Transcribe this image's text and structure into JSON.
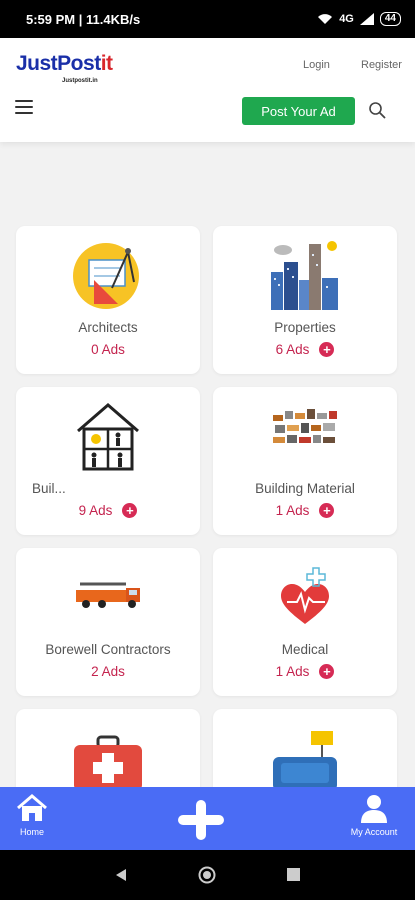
{
  "status_bar": {
    "time": "5:59 PM | 11.4KB/s",
    "network": "4G",
    "battery": "44"
  },
  "header": {
    "logo_main_a": "JustPost",
    "logo_main_b": "it",
    "logo_sub": "Justpostit.in",
    "login_label": "Login",
    "register_label": "Register",
    "post_ad_label": "Post Your Ad"
  },
  "categories": [
    {
      "title": "Architects",
      "ads": "0 Ads",
      "show_add": false,
      "icon": "architect-icon"
    },
    {
      "title": "Properties",
      "ads": "6 Ads",
      "show_add": true,
      "icon": "buildings-icon"
    },
    {
      "title": "Buil...",
      "ads": "9 Ads",
      "show_add": true,
      "icon": "builder-house-icon"
    },
    {
      "title": "Building Material",
      "ads": "1 Ads",
      "show_add": true,
      "icon": "building-material-icon"
    },
    {
      "title": "Borewell Contractors",
      "ads": "2 Ads",
      "show_add": false,
      "icon": "borewell-truck-icon"
    },
    {
      "title": "Medical",
      "ads": "1 Ads",
      "show_add": true,
      "icon": "medical-heart-icon"
    },
    {
      "title": "",
      "ads": "",
      "show_add": false,
      "icon": "first-aid-kit-icon"
    },
    {
      "title": "",
      "ads": "",
      "show_add": false,
      "icon": "sofa-icon"
    }
  ],
  "bottom_nav": {
    "home_label": "Home",
    "account_label": "My Account"
  },
  "colors": {
    "brand_blue": "#1a2fa8",
    "brand_red": "#d8262c",
    "post_green": "#1fa84f",
    "nav_blue": "#4a6cf5",
    "ads_red": "#c4234e"
  }
}
